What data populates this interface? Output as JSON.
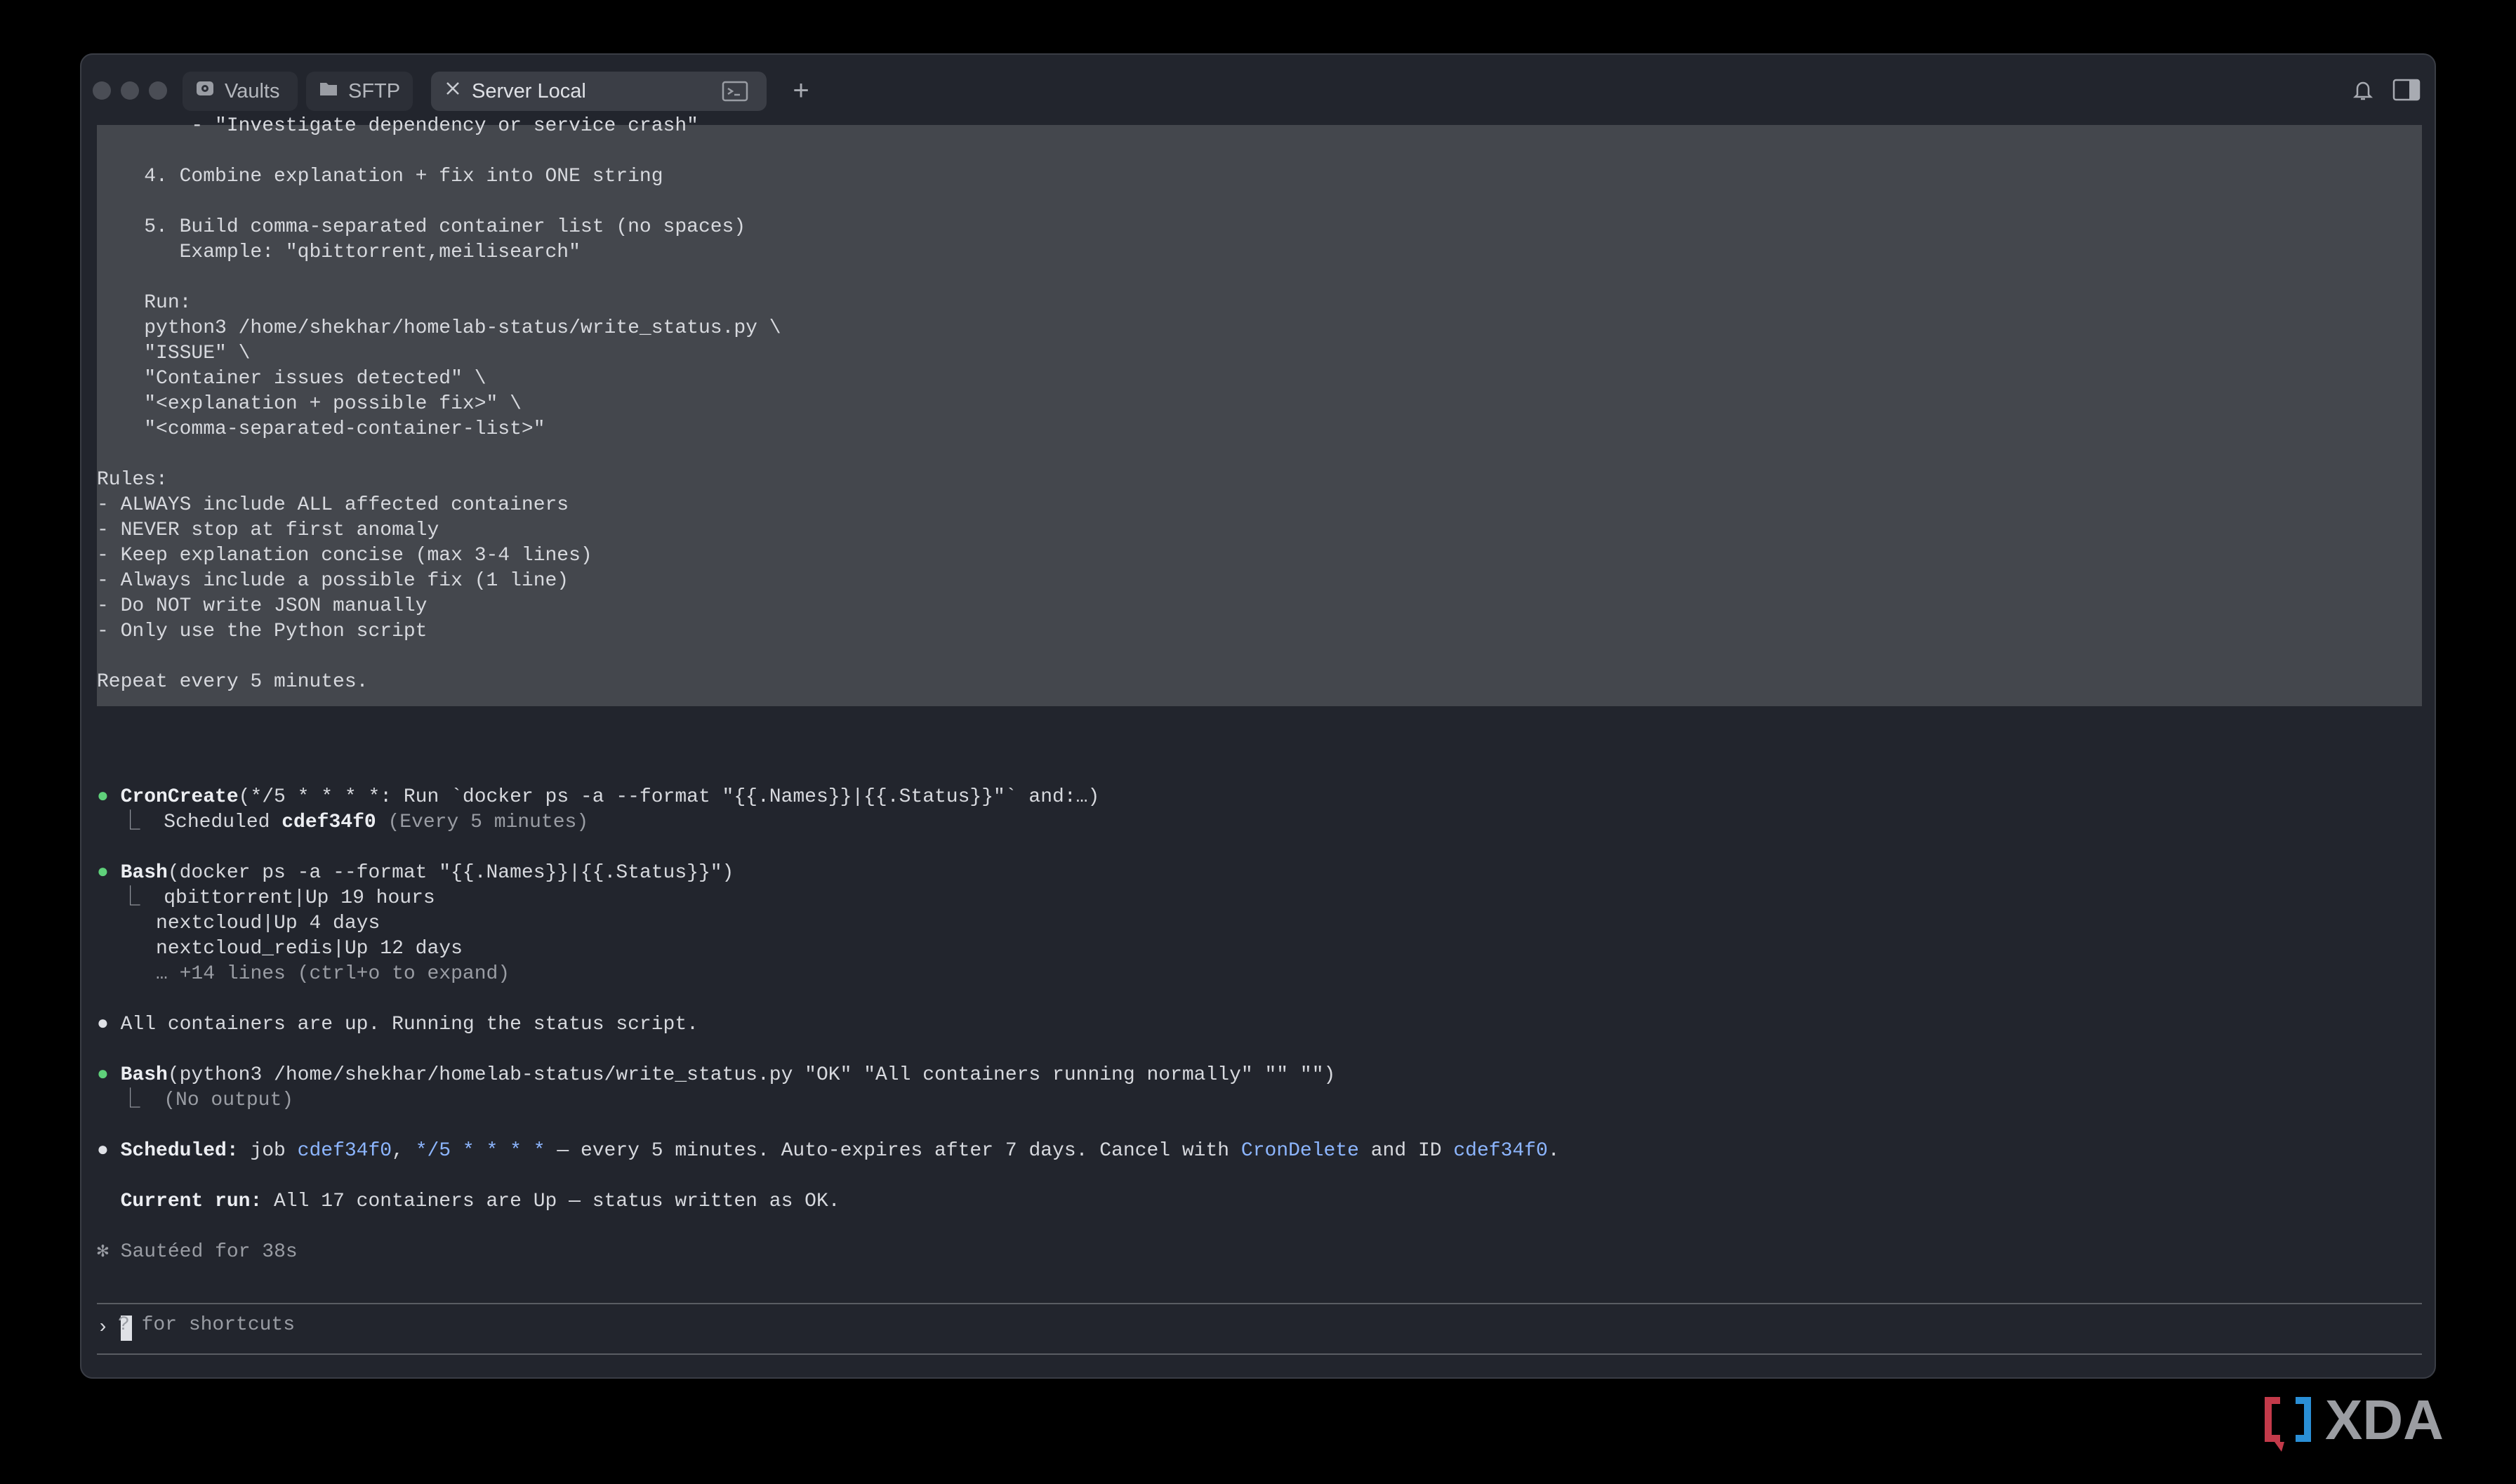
{
  "tabs": [
    {
      "label": "Vaults",
      "icon": "vault-icon"
    },
    {
      "label": "SFTP",
      "icon": "folder-icon"
    },
    {
      "label": "Server Local",
      "icon": "close-icon",
      "active": true
    }
  ],
  "terminal": {
    "prompt_lines": [
      "        - \"Investigate dependency or service crash\"",
      "",
      "    4. Combine explanation + fix into ONE string",
      "",
      "    5. Build comma-separated container list (no spaces)",
      "       Example: \"qbittorrent,meilisearch\"",
      "",
      "    Run:",
      "    python3 /home/shekhar/homelab-status/write_status.py \\",
      "    \"ISSUE\" \\",
      "    \"Container issues detected\" \\",
      "    \"<explanation + possible fix>\" \\",
      "    \"<comma-separated-container-list>\"",
      "",
      "Rules:",
      "- ALWAYS include ALL affected containers",
      "- NEVER stop at first anomaly",
      "- Keep explanation concise (max 3-4 lines)",
      "- Always include a possible fix (1 line)",
      "- Do NOT write JSON manually",
      "- Only use the Python script",
      "",
      "Repeat every 5 minutes."
    ],
    "cron": {
      "tool": "CronCreate",
      "args": "(*/5 * * * *: Run `docker ps -a --format \"{{.Names}}|{{.Status}}\"` and:…)",
      "result_prefix": "Scheduled ",
      "result_id": "cdef34f0",
      "result_suffix": " (Every 5 minutes)"
    },
    "bash1": {
      "tool": "Bash",
      "args": "(docker ps -a --format \"{{.Names}}|{{.Status}}\")",
      "output": [
        "qbittorrent|Up 19 hours",
        "nextcloud|Up 4 days",
        "nextcloud_redis|Up 12 days"
      ],
      "more": "… +14 lines (ctrl+o to expand)"
    },
    "message1": "All containers are up. Running the status script.",
    "bash2": {
      "tool": "Bash",
      "args": "(python3 /home/shekhar/homelab-status/write_status.py \"OK\" \"All containers running normally\" \"\" \"\")",
      "output": "(No output)"
    },
    "scheduled": {
      "label": "Scheduled:",
      "t1": " job ",
      "id": "cdef34f0",
      "t2": ", ",
      "cron": "*/5 * * * *",
      "t3": " — every 5 minutes. Auto-expires after 7 days. Cancel with ",
      "cmd": "CronDelete",
      "t4": " and ID ",
      "id2": "cdef34f0",
      "t5": "."
    },
    "current_run": {
      "label": "Current run:",
      "text": " All 17 containers are Up — status written as OK."
    },
    "status": "✻ Sautéed for 38s",
    "prompt_symbol": "›",
    "shortcuts_hint": "? for shortcuts"
  },
  "watermark": "XDA"
}
